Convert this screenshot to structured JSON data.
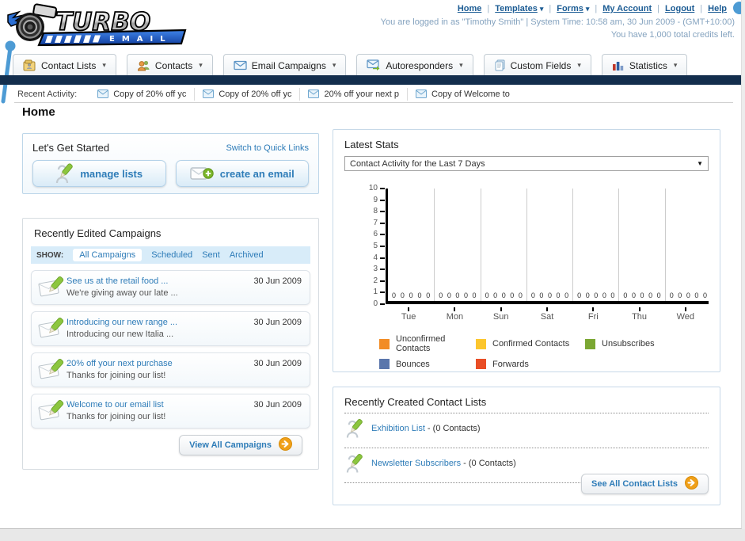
{
  "brand": {
    "name": "TURBO",
    "sub": "EMAIL"
  },
  "header": {
    "links": [
      {
        "label": "Home",
        "caret": false
      },
      {
        "label": "Templates",
        "caret": true
      },
      {
        "label": "Forms",
        "caret": true
      },
      {
        "label": "My Account",
        "caret": false
      },
      {
        "label": "Logout",
        "caret": false
      },
      {
        "label": "Help",
        "caret": false
      }
    ],
    "login_line1": "You are logged in as \"Timothy Smith\" | System Time: 10:58 am, 30 Jun 2009 - (GMT+10:00)",
    "login_line2": "You have 1,000 total credits left."
  },
  "nav_tabs": [
    {
      "label": "Contact Lists",
      "icon": "contact-lists-icon"
    },
    {
      "label": "Contacts",
      "icon": "contacts-icon"
    },
    {
      "label": "Email Campaigns",
      "icon": "email-campaigns-icon"
    },
    {
      "label": "Autoresponders",
      "icon": "autoresponders-icon"
    },
    {
      "label": "Custom Fields",
      "icon": "custom-fields-icon"
    },
    {
      "label": "Statistics",
      "icon": "statistics-icon"
    }
  ],
  "recent_activity": {
    "label": "Recent Activity:",
    "items": [
      "Copy of 20% off yc",
      "Copy of 20% off yc",
      "20% off your next p",
      "Copy of Welcome to"
    ]
  },
  "page_title": "Home",
  "get_started": {
    "title": "Let's Get Started",
    "switch_link": "Switch to Quick Links",
    "buttons": [
      {
        "label": "manage lists",
        "icon": "person-pencil-icon"
      },
      {
        "label": "create an email",
        "icon": "envelope-plus-icon"
      }
    ]
  },
  "campaigns": {
    "title": "Recently Edited Campaigns",
    "show_label": "SHOW:",
    "filters": [
      "All Campaigns",
      "Scheduled",
      "Sent",
      "Archived"
    ],
    "active_filter": "All Campaigns",
    "items": [
      {
        "title": "See us at the retail food ...",
        "subtitle": "We're giving away our late ...",
        "date": "30 Jun 2009"
      },
      {
        "title": "Introducing our new range ...",
        "subtitle": "Introducing our new Italia ...",
        "date": "30 Jun 2009"
      },
      {
        "title": "20% off your next purchase",
        "subtitle": "Thanks for joining our list!",
        "date": "30 Jun 2009"
      },
      {
        "title": "Welcome to our email list",
        "subtitle": "Thanks for joining our list!",
        "date": "30 Jun 2009"
      }
    ],
    "view_all_label": "View All Campaigns"
  },
  "stats": {
    "title": "Latest Stats",
    "dropdown_value": "Contact Activity for the Last 7 Days"
  },
  "chart_data": {
    "type": "bar",
    "title": "Contact Activity for the Last 7 Days",
    "categories": [
      "Tue",
      "Mon",
      "Sun",
      "Sat",
      "Fri",
      "Thu",
      "Wed"
    ],
    "series": [
      {
        "name": "Unconfirmed Contacts",
        "color": "#f28c26",
        "values": [
          0,
          0,
          0,
          0,
          0,
          0,
          0
        ]
      },
      {
        "name": "Confirmed Contacts",
        "color": "#fcc62e",
        "values": [
          0,
          0,
          0,
          0,
          0,
          0,
          0
        ]
      },
      {
        "name": "Unsubscribes",
        "color": "#7ba733",
        "values": [
          0,
          0,
          0,
          0,
          0,
          0,
          0
        ]
      },
      {
        "name": "Bounces",
        "color": "#5a76ac",
        "values": [
          0,
          0,
          0,
          0,
          0,
          0,
          0
        ]
      },
      {
        "name": "Forwards",
        "color": "#e94e26",
        "values": [
          0,
          0,
          0,
          0,
          0,
          0,
          0
        ]
      }
    ],
    "ylim": [
      0,
      10
    ],
    "ytick_step": 1,
    "grid": "vertical-between-groups",
    "legend_position": "bottom",
    "value_labels_shown": true
  },
  "contact_lists": {
    "title": "Recently Created Contact Lists",
    "items": [
      {
        "name": "Exhibition List",
        "detail": "- (0 Contacts)"
      },
      {
        "name": "Newsletter Subscribers",
        "detail": "- (0 Contacts)"
      }
    ],
    "see_all_label": "See All Contact Lists"
  },
  "colors": {
    "navy_bar": "#132e4d",
    "link_blue": "#2e7cb8",
    "header_link_blue": "#1c5c94",
    "accent_orange": "#f0a019",
    "accent_green": "#8cc63f",
    "filter_bar_blue": "#d8ecf9",
    "decor_dot_blue": "#4d9bd4"
  }
}
